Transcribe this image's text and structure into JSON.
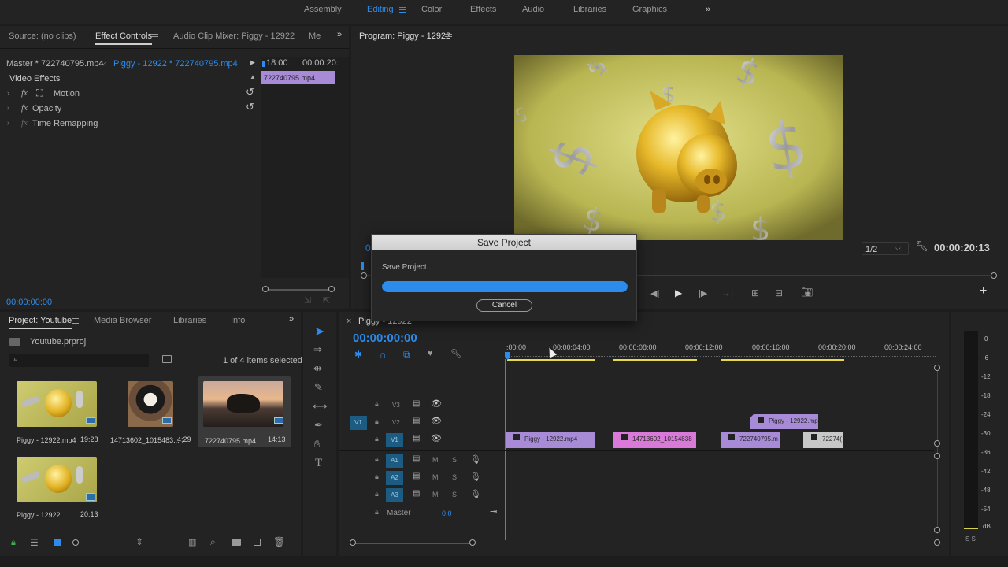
{
  "workspaces": {
    "items": [
      "Assembly",
      "Editing",
      "Color",
      "Effects",
      "Audio",
      "Libraries",
      "Graphics"
    ],
    "active": "Editing",
    "more": "»"
  },
  "source_panel": {
    "tabs": [
      "Source: (no clips)",
      "Effect Controls",
      "Audio Clip Mixer: Piggy - 12922",
      "Me"
    ],
    "more": "»"
  },
  "effect_controls": {
    "master": "Master * 722740795.mp4",
    "clip": "Piggy - 12922 * 722740795.mp4",
    "ruler_start": "18:00",
    "ruler_end": "00:00:20:",
    "clip_label": "722740795.mp4",
    "section": "Video Effects",
    "effects": [
      "Motion",
      "Opacity",
      "Time Remapping"
    ],
    "fx": "fx",
    "timecode": "00:00:00:00"
  },
  "program": {
    "title": "Program: Piggy - 12922",
    "quality": "1/2",
    "timecode": "00:00:20:13",
    "left_tc_partial": "0"
  },
  "dialog": {
    "title": "Save Project",
    "message": "Save Project...",
    "progress": 1.0,
    "cancel": "Cancel"
  },
  "project": {
    "tabs": [
      "Project: Youtube",
      "Media Browser",
      "Libraries",
      "Info"
    ],
    "more": "»",
    "file": "Youtube.prproj",
    "search_placeholder": "",
    "selection": "1 of 4 items selected",
    "items": [
      {
        "name": "Piggy - 12922.mp4",
        "duration": "19:28"
      },
      {
        "name": "14713602_1015483...",
        "duration": "4;29"
      },
      {
        "name": "722740795.mp4",
        "duration": "14:13"
      },
      {
        "name": "Piggy - 12922",
        "duration": "20:13"
      }
    ]
  },
  "timeline": {
    "tab": "Piggy - 12922",
    "close": "×",
    "timecode": "00:00:00:00",
    "ruler": [
      ":00:00",
      "00:00:04:00",
      "00:00:08:00",
      "00:00:12:00",
      "00:00:16:00",
      "00:00:20:00",
      "00:00:24:00"
    ],
    "video_tracks": [
      "V3",
      "V2",
      "V1"
    ],
    "source_patch": "V1",
    "audio_tracks": [
      "A1",
      "A2",
      "A3"
    ],
    "master_label": "Master",
    "master_value": "0.0",
    "m": "M",
    "s": "S",
    "clips_v1": [
      "Piggy - 12922.mp4",
      "14713602_10154838",
      "722740795.m",
      "72274("
    ],
    "clips_v2": [
      "Piggy - 12922.mp"
    ]
  },
  "meter": {
    "scale": [
      "0",
      "-6",
      "-12",
      "-18",
      "-24",
      "-30",
      "-36",
      "-42",
      "-48",
      "-54",
      "dB"
    ],
    "solo": "S S"
  },
  "tools": [
    "selection-tool",
    "track-select-tool",
    "ripple-edit-tool",
    "razor-tool",
    "slip-tool",
    "pen-tool",
    "hand-tool",
    "type-tool"
  ],
  "colors": {
    "accent": "#2d8ceb",
    "clip_purple": "#a78bd6",
    "clip_pink": "#d97ad8",
    "clip_gray": "#c8c8c8",
    "track_blue": "#1c5b82",
    "panel": "#232323",
    "bg": "#1d1d1d"
  }
}
